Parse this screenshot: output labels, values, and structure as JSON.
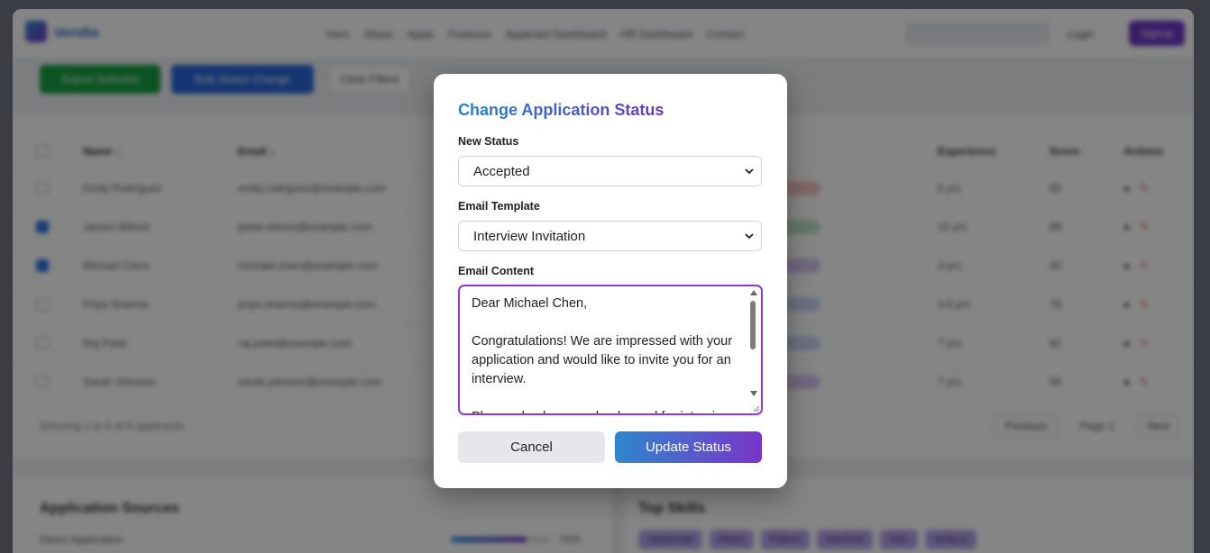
{
  "background": {
    "brand": "Veridia",
    "nav_links": [
      "Hero",
      "About",
      "Apply",
      "Features",
      "Applicant Dashboard",
      "HR Dashboard",
      "Contact"
    ],
    "login": "Login",
    "signup": "Signup",
    "toolbar": {
      "export": "Export Selected",
      "bulk": "Bulk Status Change",
      "clear": "Clear Filters"
    },
    "table": {
      "headers": {
        "name": "Name ↓",
        "email": "Email ↓",
        "experience": "Experience",
        "score": "Score",
        "actions": "Actions"
      },
      "rows": [
        {
          "name": "Emily Rodriguez",
          "email": "emily.rodriguez@example.com",
          "exp": "5 yrs",
          "score": "85",
          "checked": false,
          "pill": "#f4c4c4"
        },
        {
          "name": "James Wilson",
          "email": "jamie.wilson@example.com",
          "exp": "10 yrs",
          "score": "88",
          "checked": true,
          "pill": "#bde5c6"
        },
        {
          "name": "Michael Chen",
          "email": "michael.chen@example.com",
          "exp": "3 yrs",
          "score": "92",
          "checked": true,
          "pill": "#d6c7f3"
        },
        {
          "name": "Priya Sharma",
          "email": "priya.sharma@example.com",
          "exp": "4.6 yrs",
          "score": "78",
          "checked": false,
          "pill": "#c9d8f5"
        },
        {
          "name": "Raj Patel",
          "email": "raj.patel@example.com",
          "exp": "7 yrs",
          "score": "82",
          "checked": false,
          "pill": "#c9d8f5"
        },
        {
          "name": "Sarah Johnson",
          "email": "sarah.johnson@example.com",
          "exp": "7 yrs",
          "score": "95",
          "checked": false,
          "pill": "#d6c7f3"
        }
      ],
      "footer": "Showing 1 to 6 of 6 applicants",
      "previous": "Previous",
      "page": "Page 1",
      "next": "Next"
    },
    "sources": {
      "title": "Application Sources",
      "row_label": "Direct Application",
      "row_pct": "76%",
      "row_fraction": 0.76
    },
    "skills": {
      "title": "Top Skills",
      "tags": [
        "JavaScript",
        "React",
        "Python",
        "Machine",
        "SQL",
        "Node.js"
      ]
    }
  },
  "modal": {
    "title": "Change Application Status",
    "status_label": "New Status",
    "status_value": "Accepted",
    "template_label": "Email Template",
    "template_value": "Interview Invitation",
    "content_label": "Email Content",
    "content_text": "Dear Michael Chen,\n\nCongratulations! We are impressed with your application and would like to invite you for an interview.\n\nPlease check your calendar and for interview",
    "cancel_label": "Cancel",
    "update_label": "Update Status"
  }
}
